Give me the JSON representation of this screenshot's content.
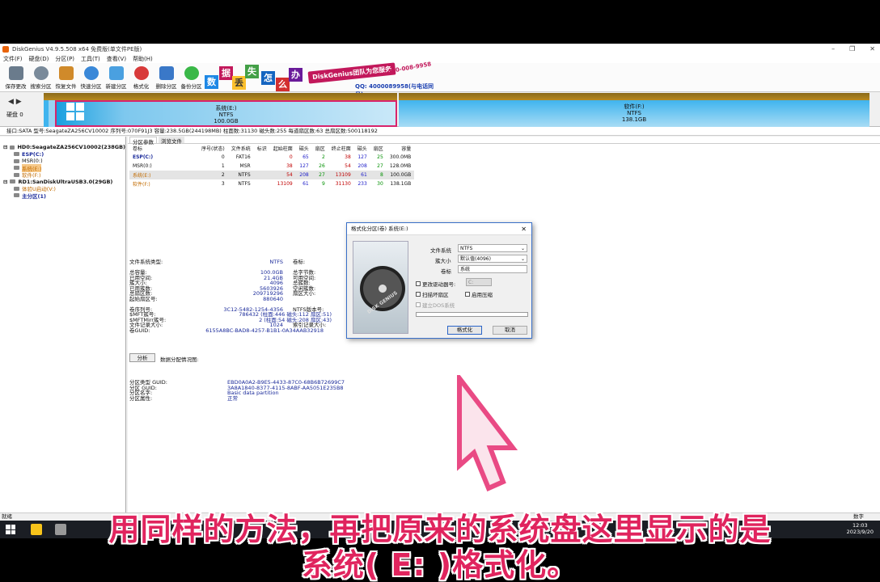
{
  "window": {
    "title": "DiskGenius V4.9.5.508 x64 免费版(单文件PE版)"
  },
  "menu": [
    "文件(F)",
    "硬盘(D)",
    "分区(P)",
    "工具(T)",
    "查看(V)",
    "帮助(H)"
  ],
  "toolbar": [
    {
      "label": "保存更改",
      "icon": "save-icon",
      "color": "#6a7b8c"
    },
    {
      "label": "搜索分区",
      "icon": "search-icon",
      "color": "#7a8a9a"
    },
    {
      "label": "恢复文件",
      "icon": "recover-icon",
      "color": "#d08a2a"
    },
    {
      "label": "快速分区",
      "icon": "quick-partition-icon",
      "color": "#3a88d8"
    },
    {
      "label": "新建分区",
      "icon": "new-partition-icon",
      "color": "#4aa0e0"
    },
    {
      "label": "格式化",
      "icon": "format-icon",
      "color": "#d83a3a"
    },
    {
      "label": "删除分区",
      "icon": "delete-icon",
      "color": "#3a78c8"
    },
    {
      "label": "备份分区",
      "icon": "backup-icon",
      "color": "#3ab848"
    }
  ],
  "banner": {
    "tiles": [
      {
        "char": "数",
        "color": "#1e88e5"
      },
      {
        "char": "据",
        "color": "#c2185b"
      },
      {
        "char": "丢",
        "color": "#fbc02d"
      },
      {
        "char": "失",
        "color": "#43a047"
      },
      {
        "char": "怎",
        "color": "#1565c0"
      },
      {
        "char": "么",
        "color": "#d32f2f"
      },
      {
        "char": "办",
        "color": "#6a1b9a"
      }
    ],
    "slogan": "DiskGenius团队为您服务",
    "phone": "400-008-9958",
    "qq": "QQ: 4000089958(与电话同号)"
  },
  "diskmap": {
    "disk_label": "硬盘 0",
    "partitions": [
      {
        "name": "系统(E:)",
        "fs": "NTFS",
        "size": "100.0GB"
      },
      {
        "name": "软件(F:)",
        "fs": "NTFS",
        "size": "138.1GB"
      }
    ]
  },
  "infobar": "接口:SATA  型号:SeagateZA256CV10002  序列号:070F91J3  容量:238.5GB(244198MB)  柱面数:31130  磁头数:255  每道扇区数:63  总扇区数:500118192",
  "tree": [
    {
      "label": "HD0:SeagateZA256CV10002(238GB)",
      "level": 0,
      "style": "bold"
    },
    {
      "label": "ESP(C:)",
      "level": 1,
      "style": "blue-bold"
    },
    {
      "label": "MSR(0:)",
      "level": 1,
      "style": ""
    },
    {
      "label": "系统(E:)",
      "level": 1,
      "style": "orange-sel"
    },
    {
      "label": "软件(F:)",
      "level": 1,
      "style": "orange"
    },
    {
      "label": "RD1:SanDiskUltraUSB3.0(29GB)",
      "level": 0,
      "style": "bold"
    },
    {
      "label": "体验U启动(V:)",
      "level": 1,
      "style": "orange"
    },
    {
      "label": "主分区(1)",
      "level": 1,
      "style": "blue-bold"
    }
  ],
  "tabs": [
    "分区参数",
    "浏览文件"
  ],
  "table": {
    "headers": [
      "卷标",
      "序号(状态)",
      "文件系统",
      "标识",
      "起始柱面",
      "磁头",
      "扇区",
      "终止柱面",
      "磁头",
      "扇区",
      "容量"
    ],
    "rows": [
      [
        "ESP(C:)",
        "0",
        "FAT16",
        "",
        "0",
        "65",
        "2",
        "38",
        "127",
        "25",
        "300.0MB"
      ],
      [
        "MSR(0:)",
        "1",
        "MSR",
        "",
        "38",
        "127",
        "26",
        "54",
        "208",
        "27",
        "128.0MB"
      ],
      [
        "系统(E:)",
        "2",
        "NTFS",
        "",
        "54",
        "208",
        "27",
        "13109",
        "61",
        "8",
        "100.0GB"
      ],
      [
        "软件(F:)",
        "3",
        "NTFS",
        "",
        "13109",
        "61",
        "9",
        "31130",
        "233",
        "30",
        "138.1GB"
      ]
    ]
  },
  "props": {
    "fs_type_label": "文件系统类型:",
    "fs_type_value": "NTFS",
    "volume_label_key": "卷标:",
    "volume_label_value": "系统",
    "rows": [
      {
        "k": "总容量:",
        "v": "100.0GB",
        "k2": "总字节数:"
      },
      {
        "k": "已用空间:",
        "v": "21.4GB",
        "k2": "可用空间:"
      },
      {
        "k": "簇大小:",
        "v": "4096",
        "k2": "总簇数:"
      },
      {
        "k": "已用簇数:",
        "v": "5603926",
        "k2": "空闲簇数:"
      },
      {
        "k": "总扇区数:",
        "v": "209719296",
        "k2": "扇区大小:"
      },
      {
        "k": "起始扇区号:",
        "v": "880640",
        "k2": ""
      }
    ],
    "rows2": [
      {
        "k": "卷序列号:",
        "v": "3C12-5482-1254-4356",
        "k2": "NTFS版本号:"
      },
      {
        "k": "$MFT簇号:",
        "v": "786432 (柱面:446 磁头:112 扇区:51)",
        "k2": ""
      },
      {
        "k": "$MFTMirr簇号:",
        "v": "2 (柱面:54 磁头:208 扇区:43)",
        "k2": ""
      },
      {
        "k": "文件记录大小:",
        "v": "1024",
        "k2": "索引记录大小:"
      },
      {
        "k": "卷GUID:",
        "v": "6155A8BC-BAD8-4257-B1B1-0A34AAB32918",
        "k2": ""
      }
    ],
    "analyze_button": "分析",
    "analyze_label": "数据分配情况图:",
    "guids": [
      {
        "k": "分区类型 GUID:",
        "v": "EBD0A0A2-B9E5-4433-87C0-68B6B72699C7"
      },
      {
        "k": "分区 GUID:",
        "v": "3A8A1840-8377-4115-8ABF-AA5051E235B8"
      },
      {
        "k": "分区名字:",
        "v": "Basic data partition"
      },
      {
        "k": "分区属性:",
        "v": "正常"
      }
    ]
  },
  "dialog": {
    "title": "格式化分区(卷) 系统(E:)",
    "close": "✕",
    "fs_label": "文件系统",
    "fs_value": "NTFS",
    "cluster_label": "簇大小",
    "cluster_value": "默认值(4096)",
    "vol_label": "卷标",
    "vol_value": "系统",
    "chk_boot": "更改驱动器号:",
    "boot_drive": "C:",
    "chk_scan": "扫描坏扇区",
    "chk_compress": "启用压缩",
    "chk_dos": "建立DOS系统",
    "brand": "DISK GENIUS",
    "format_button": "格式化",
    "cancel_button": "取消"
  },
  "status": {
    "left": "就绪",
    "right": "数字"
  },
  "clock": {
    "time": "12:03",
    "date": "2023/9/20"
  },
  "subtitle": {
    "line1": "用同样的方法，再把原来的系统盘这里显示的是",
    "line2": "系统( E: )格式化。"
  }
}
